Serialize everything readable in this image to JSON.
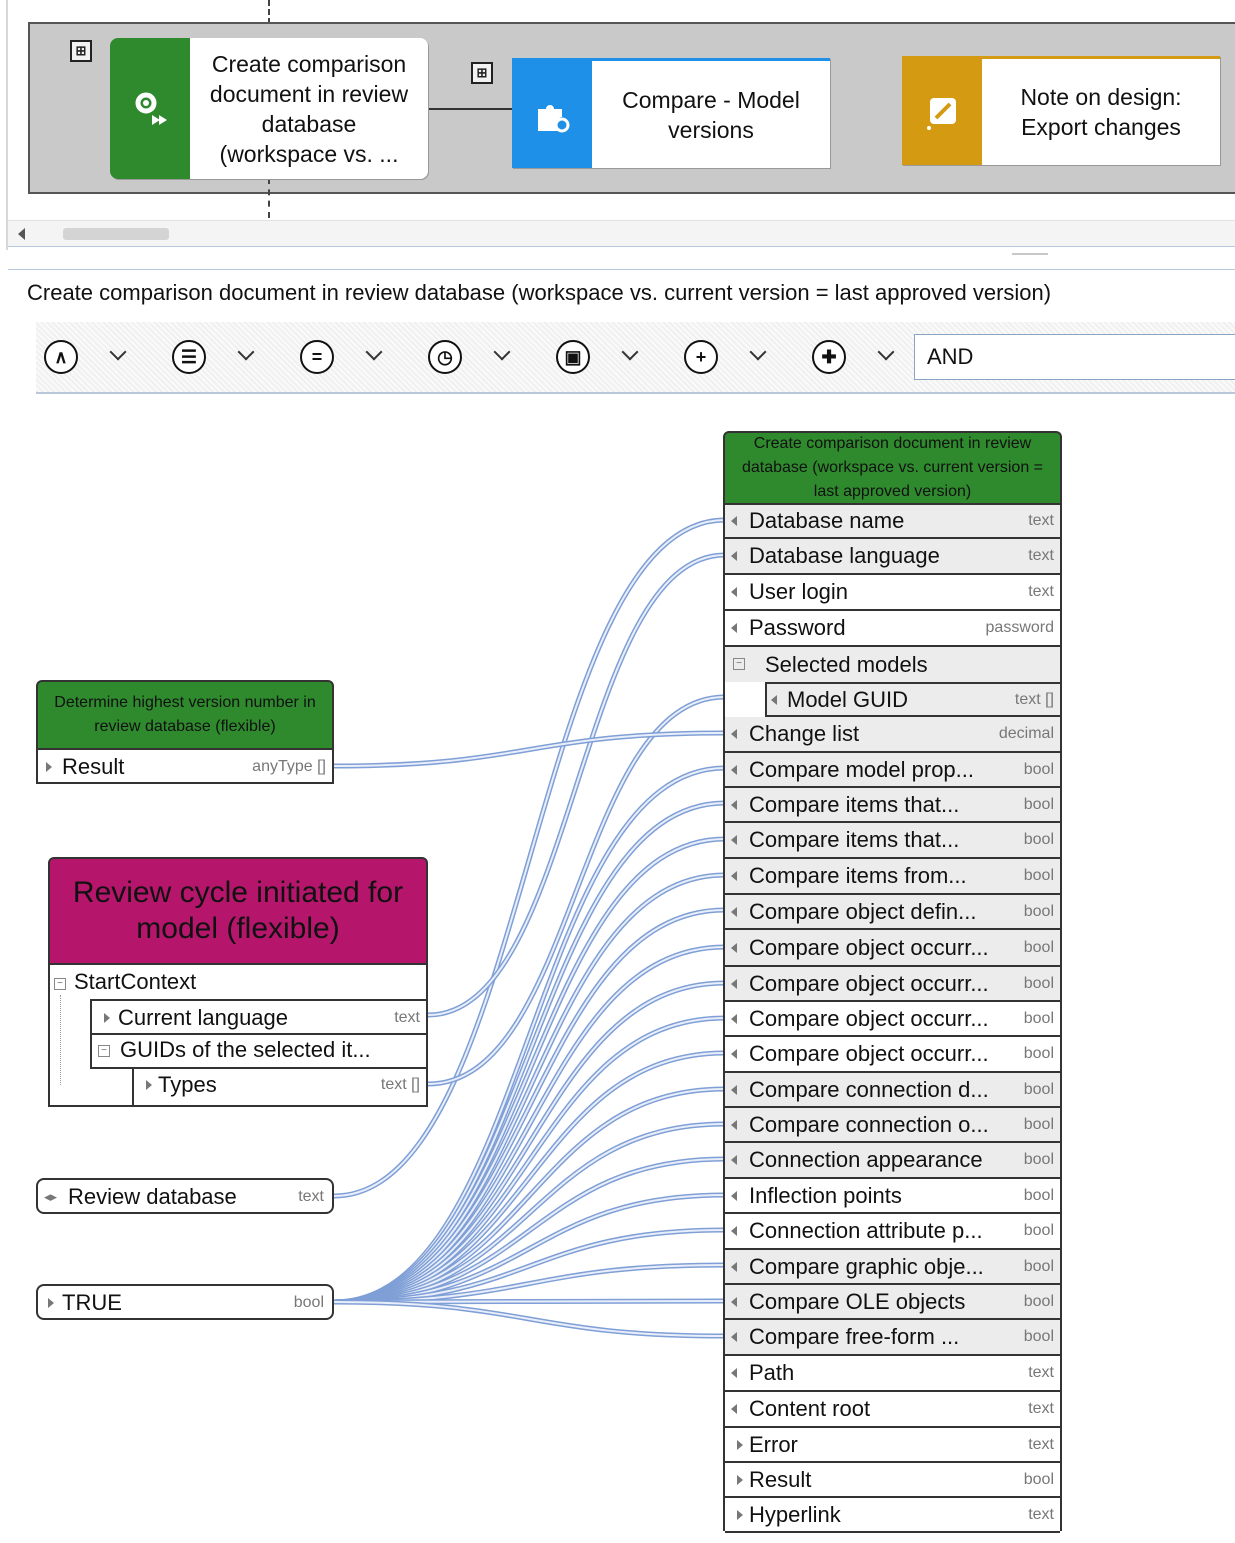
{
  "process": {
    "steps": [
      {
        "label": "Create comparison document in review database (workspace vs. ...",
        "color": "#2f8a2e",
        "icon": "gear-play-icon"
      },
      {
        "label": "Compare - Model versions",
        "color": "#1e90e8",
        "icon": "puzzle-gear-icon"
      },
      {
        "label": "Note on design: Export changes",
        "color": "#d49a12",
        "icon": "note-pencil-icon"
      }
    ]
  },
  "detail": {
    "title": "Create comparison document in review database (workspace vs. current version = last approved version)"
  },
  "toolbar": {
    "buttons": [
      {
        "icon": "caret-up-icon",
        "glyph": "∧"
      },
      {
        "icon": "list-icon",
        "glyph": "☰"
      },
      {
        "icon": "equals-icon",
        "glyph": "="
      },
      {
        "icon": "clock-icon",
        "glyph": "◷"
      },
      {
        "icon": "document-icon",
        "glyph": "▣"
      },
      {
        "icon": "plus-icon",
        "glyph": "+"
      },
      {
        "icon": "add-function-icon",
        "glyph": "✚"
      }
    ],
    "operator": "AND"
  },
  "sources": {
    "highest_version": {
      "title": "Determine highest version number in review database (flexible)",
      "rows": [
        {
          "label": "Result",
          "type": "anyType []"
        }
      ],
      "color": "#2f8a2e"
    },
    "review_cycle": {
      "title": "Review cycle initiated for model (flexible)",
      "color": "#b5166b",
      "rows": [
        {
          "label": "StartContext",
          "type": ""
        },
        {
          "label": "Current language",
          "type": "text"
        },
        {
          "label": "GUIDs of the selected it...",
          "type": ""
        },
        {
          "label": "Types",
          "type": "text []"
        }
      ]
    },
    "review_database": {
      "label": "Review database",
      "type": "text"
    },
    "true_constant": {
      "label": "TRUE",
      "type": "bool"
    }
  },
  "target": {
    "title": "Create comparison document in review database (workspace vs. current version = last approved version)",
    "rows": [
      {
        "label": "Database name",
        "type": "text"
      },
      {
        "label": "Database language",
        "type": "text"
      },
      {
        "label": "User login",
        "type": "text"
      },
      {
        "label": "Password",
        "type": "password"
      },
      {
        "label": "Selected models",
        "type": ""
      },
      {
        "label": "Model GUID",
        "type": "text []"
      },
      {
        "label": "Change list",
        "type": "decimal"
      },
      {
        "label": "Compare model prop...",
        "type": "bool"
      },
      {
        "label": "Compare items that...",
        "type": "bool"
      },
      {
        "label": "Compare items that...",
        "type": "bool"
      },
      {
        "label": "Compare items from...",
        "type": "bool"
      },
      {
        "label": "Compare object defin...",
        "type": "bool"
      },
      {
        "label": "Compare object occurr...",
        "type": "bool"
      },
      {
        "label": "Compare object occurr...",
        "type": "bool"
      },
      {
        "label": "Compare object occurr...",
        "type": "bool"
      },
      {
        "label": "Compare object occurr...",
        "type": "bool"
      },
      {
        "label": "Compare connection d...",
        "type": "bool"
      },
      {
        "label": "Compare connection o...",
        "type": "bool"
      },
      {
        "label": "Connection appearance",
        "type": "bool"
      },
      {
        "label": "Inflection points",
        "type": "bool"
      },
      {
        "label": "Connection attribute p...",
        "type": "bool"
      },
      {
        "label": "Compare graphic obje...",
        "type": "bool"
      },
      {
        "label": "Compare OLE objects",
        "type": "bool"
      },
      {
        "label": "Compare free-form ...",
        "type": "bool"
      },
      {
        "label": "Path",
        "type": "text"
      },
      {
        "label": "Content root",
        "type": "text"
      },
      {
        "label": "Error",
        "type": "text"
      },
      {
        "label": "Result",
        "type": "bool"
      },
      {
        "label": "Hyperlink",
        "type": "text"
      }
    ]
  }
}
